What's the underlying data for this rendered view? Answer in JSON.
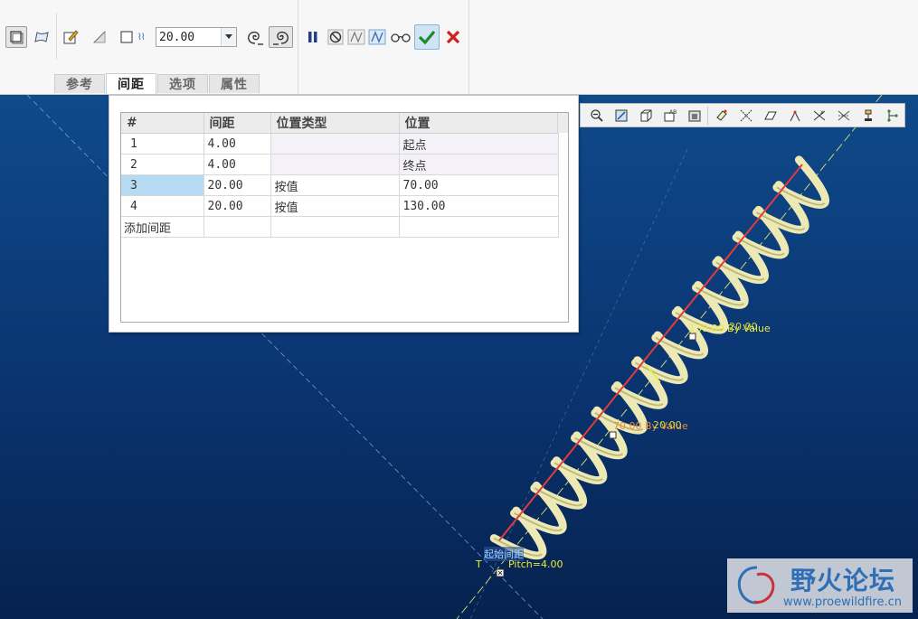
{
  "dashboard": {
    "pitch_value": "20.00",
    "tabs": [
      {
        "label": "参考",
        "active": false
      },
      {
        "label": "间距",
        "active": true
      },
      {
        "label": "选项",
        "active": false
      },
      {
        "label": "属性",
        "active": false
      }
    ],
    "icons": {
      "solid": "solid-icon",
      "surface": "surface-icon",
      "sketch": "sketch-edit-icon",
      "remove_material": "remove-material-icon",
      "thicken": "thicken-icon",
      "pitch": "pitch-icon",
      "left_handed": "left-hand-rule-icon",
      "right_handed": "right-hand-rule-icon",
      "pause": "pause-icon",
      "no_preview": "no-preview-icon",
      "geometry_preview": "geometry-preview-icon",
      "feature_preview": "feature-preview-icon",
      "verify": "verify-glasses-icon",
      "ok": "ok-check-icon",
      "cancel": "cancel-x-icon"
    }
  },
  "pitch_table": {
    "columns": [
      "#",
      "间距",
      "位置类型",
      "位置"
    ],
    "rows": [
      {
        "index": "1",
        "pitch": "4.00",
        "location_type": "",
        "location": "起点"
      },
      {
        "index": "2",
        "pitch": "4.00",
        "location_type": "",
        "location": "终点"
      },
      {
        "index": "3",
        "pitch": "20.00",
        "location_type": "按值",
        "location": "70.00"
      },
      {
        "index": "4",
        "pitch": "20.00",
        "location_type": "按值",
        "location": "130.00"
      }
    ],
    "add_row_label": "添加间距"
  },
  "graphics_toolbar": {
    "icons": [
      "zoom-out-icon",
      "refit-icon",
      "shading-icon",
      "saved-views-icon",
      "display-style-icon",
      "datum-planes-icon",
      "datum-axes-icon",
      "sketch-view-icon",
      "point-display-icon",
      "csys-icon",
      "annotation-icon",
      "spin-center-icon",
      "model-tree-icon"
    ]
  },
  "viewport": {
    "annotations": {
      "pitch_130": "130.00 By Value",
      "pitch_130_val": "20.00",
      "pitch_70": "70.00 By Value",
      "pitch_70_val": "20.00",
      "start_label": "Pitch=4.00",
      "start_prefix": "T",
      "start_tag": "起始间距"
    },
    "colors": {
      "background": "#0c3a74",
      "spring": "#ece9b4",
      "axis": "#e23b3b",
      "construction": "#e9ec3a"
    }
  },
  "watermark": {
    "title": "野火论坛",
    "url": "www.proewildfire.cn"
  }
}
